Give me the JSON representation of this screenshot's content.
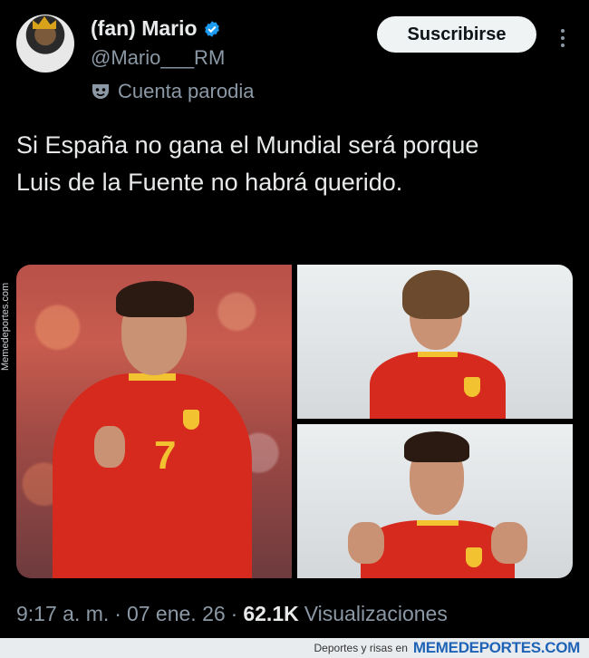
{
  "tweet": {
    "display_name": "(fan) Mario",
    "handle": "@Mario___RM",
    "account_label": "Cuenta parodia",
    "subscribe_label": "Suscribirse",
    "text": "Si España no gana el Mundial será porque Luis de la Fuente no habrá querido.",
    "time": "9:17 a. m.",
    "separator": "·",
    "date": "07 ene. 26",
    "views_count": "62.1K",
    "views_label": "Visualizaciones",
    "jersey_number": "7"
  },
  "watermark": {
    "side_text": "Memedeportes.com",
    "bottom_prefix": "Deportes y risas en",
    "bottom_brand": "MEMEDEPORTES.COM"
  },
  "icons": {
    "verified": "verified-badge-icon",
    "parody": "parody-mask-icon",
    "more": "more-options-icon"
  },
  "colors": {
    "background": "#000000",
    "text_primary": "#e7e9ea",
    "text_secondary": "#8b98a5",
    "verified_blue": "#1d9bf0",
    "spain_red": "#d62a1e",
    "spain_yellow": "#f2c230"
  }
}
